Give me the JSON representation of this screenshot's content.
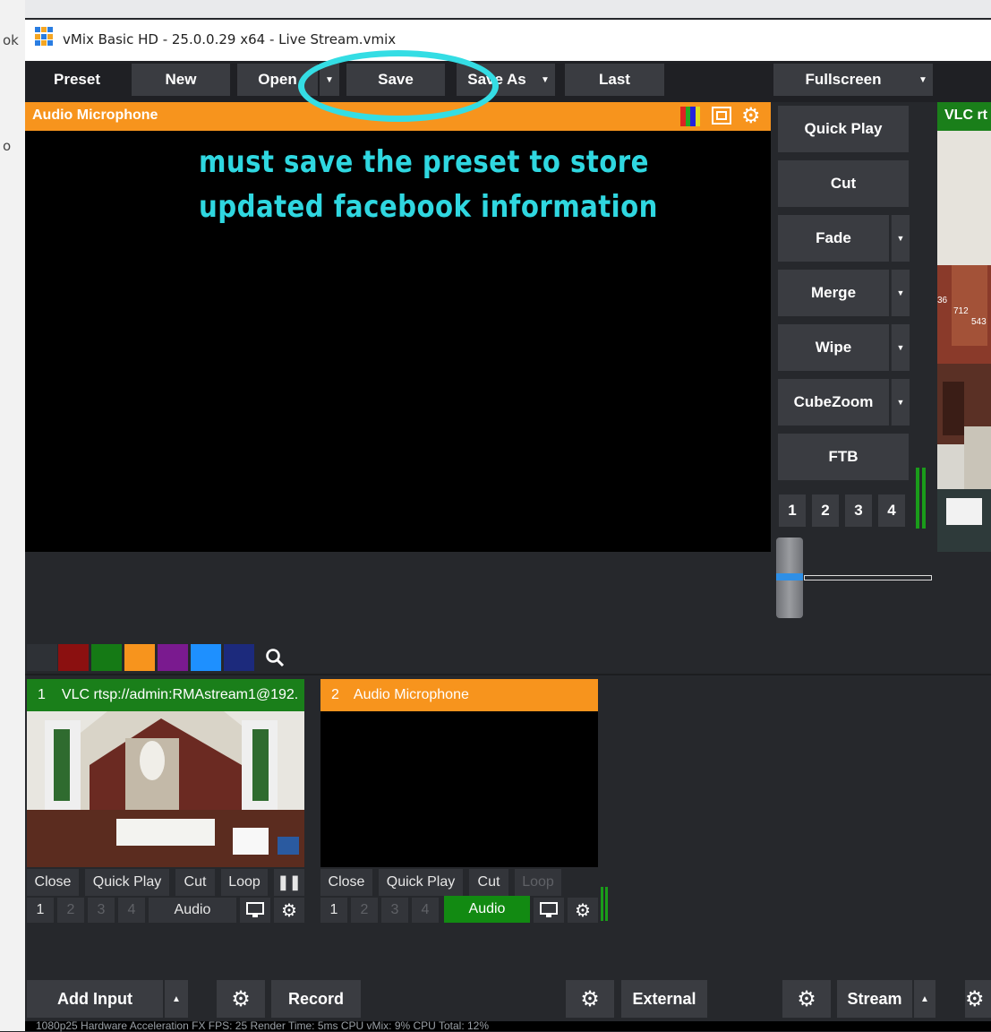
{
  "outer": {
    "left_fragments": [
      "ok",
      "o"
    ]
  },
  "window": {
    "title": "vMix Basic HD - 25.0.0.29 x64 - Live Stream.vmix"
  },
  "toolbar": {
    "preset": "Preset",
    "new": "New",
    "open": "Open",
    "save": "Save",
    "save_as": "Save As",
    "last": "Last",
    "fullscreen": "Fullscreen"
  },
  "preview": {
    "title": "Audio Microphone",
    "annotation_line1": "must save the preset to store",
    "annotation_line2": "updated facebook information"
  },
  "transitions": {
    "quick_play": "Quick Play",
    "cut": "Cut",
    "fade": "Fade",
    "merge": "Merge",
    "wipe": "Wipe",
    "cubezoom": "CubeZoom",
    "ftb": "FTB",
    "numbers": [
      "1",
      "2",
      "3",
      "4"
    ]
  },
  "output": {
    "title": "VLC rt",
    "overlay_numbers": [
      "36",
      "712",
      "543"
    ]
  },
  "filters": {
    "colors": [
      "#2e3136",
      "#8b1010",
      "#157a15",
      "#f7941d",
      "#7a1a8f",
      "#1e90ff",
      "#1c2a7c"
    ]
  },
  "inputs": [
    {
      "number": "1",
      "title": "VLC rtsp://admin:RMAstream1@192.",
      "header_color": "#1a7f1a",
      "buttons": [
        "Close",
        "Quick Play",
        "Cut",
        "Loop"
      ],
      "numbers": [
        "1",
        "2",
        "3",
        "4"
      ],
      "audio": "Audio"
    },
    {
      "number": "2",
      "title": "Audio Microphone",
      "header_color": "#f7941d",
      "buttons": [
        "Close",
        "Quick Play",
        "Cut",
        "Loop"
      ],
      "numbers": [
        "1",
        "2",
        "3",
        "4"
      ],
      "audio": "Audio"
    }
  ],
  "bottom": {
    "add_input": "Add Input",
    "record": "Record",
    "external": "External",
    "stream": "Stream"
  },
  "status": {
    "text": "1080p25  Hardware Acceleration  FX  FPS: 25  Render Time: 5ms  CPU vMix: 9%  CPU Total: 12%"
  }
}
